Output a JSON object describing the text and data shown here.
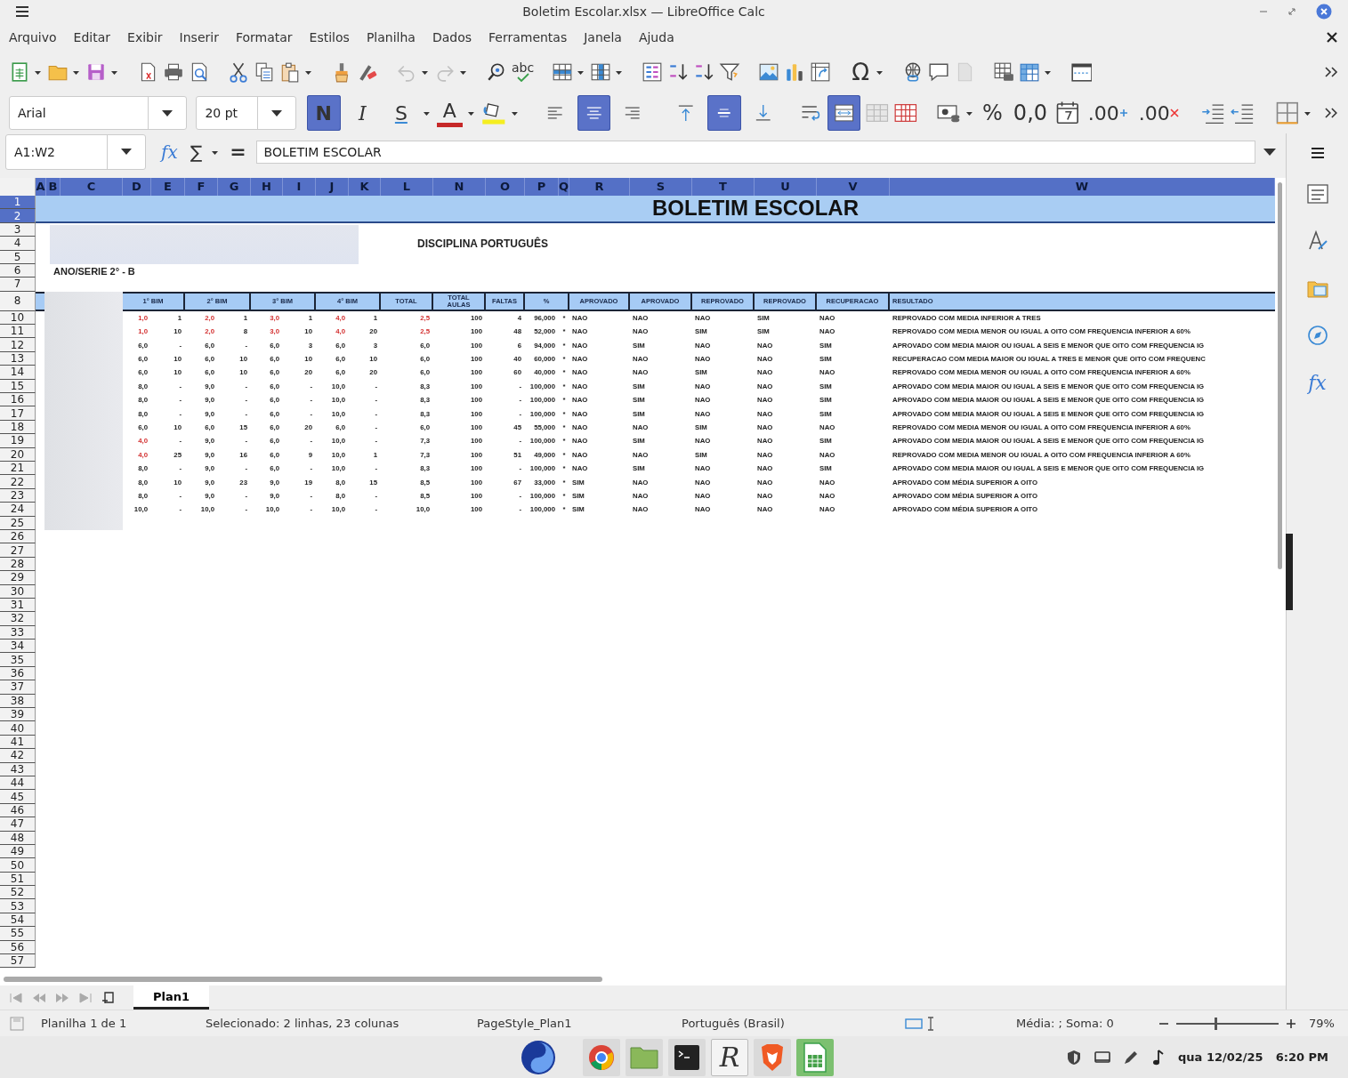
{
  "window": {
    "title": "Boletim Escolar.xlsx — LibreOffice Calc"
  },
  "menu": [
    "Arquivo",
    "Editar",
    "Exibir",
    "Inserir",
    "Formatar",
    "Estilos",
    "Planilha",
    "Dados",
    "Ferramentas",
    "Janela",
    "Ajuda"
  ],
  "standard_toolbar": {
    "spellcheck_label": "abc",
    "special_character": "Ω"
  },
  "formatting_toolbar": {
    "font_name": "Arial",
    "font_size": "20 pt",
    "bold": {
      "label": "N",
      "selected": true
    },
    "italic": {
      "label": "I",
      "selected": false
    },
    "underline": {
      "label": "S",
      "selected": false
    },
    "font_color": {
      "label": "A"
    },
    "horizontal_align": [
      {
        "selected": false
      },
      {
        "selected": true
      },
      {
        "selected": false
      }
    ],
    "vertical_align": [
      {
        "selected": false
      },
      {
        "selected": true
      },
      {
        "selected": false
      }
    ],
    "merge_and_center": {
      "selected": true
    },
    "percent": "%",
    "number_format": "0,0",
    "add_decimal": ".00",
    "delete_decimal": ".00"
  },
  "formula_bar": {
    "name_box": "A1:W2",
    "function_wizard": "fx",
    "sum": "∑",
    "equals": "=",
    "value": "BOLETIM ESCOLAR"
  },
  "sheet": {
    "column_headers": [
      {
        "label": "A",
        "selected": true
      },
      {
        "label": "B",
        "selected": true
      },
      {
        "label": "C",
        "selected": true
      },
      {
        "label": "D",
        "selected": true
      },
      {
        "label": "E",
        "selected": true
      },
      {
        "label": "F",
        "selected": true
      },
      {
        "label": "G",
        "selected": true
      },
      {
        "label": "H",
        "selected": true
      },
      {
        "label": "I",
        "selected": true
      },
      {
        "label": "J",
        "selected": true
      },
      {
        "label": "K",
        "selected": true
      },
      {
        "label": "L",
        "selected": true
      },
      {
        "label": "N",
        "selected": true
      },
      {
        "label": "O",
        "selected": true
      },
      {
        "label": "P",
        "selected": true
      },
      {
        "label": "Q",
        "selected": true
      },
      {
        "label": "R",
        "selected": true
      },
      {
        "label": "S",
        "selected": true
      },
      {
        "label": "T",
        "selected": true
      },
      {
        "label": "U",
        "selected": true
      },
      {
        "label": "V",
        "selected": true
      },
      {
        "label": "W",
        "selected": true
      }
    ],
    "row_headers": [
      {
        "label": "1",
        "selected": true
      },
      {
        "label": "2",
        "selected": true
      },
      {
        "label": "3",
        "selected": false
      },
      {
        "label": "4",
        "selected": false
      },
      {
        "label": "5",
        "selected": false
      },
      {
        "label": "6",
        "selected": false
      },
      {
        "label": "7",
        "selected": false
      },
      {
        "label": "8",
        "selected": false
      },
      {
        "label": "10",
        "selected": false
      },
      {
        "label": "11",
        "selected": false
      },
      {
        "label": "12",
        "selected": false
      },
      {
        "label": "13",
        "selected": false
      },
      {
        "label": "14",
        "selected": false
      },
      {
        "label": "15",
        "selected": false
      },
      {
        "label": "16",
        "selected": false
      },
      {
        "label": "17",
        "selected": false
      },
      {
        "label": "18",
        "selected": false
      },
      {
        "label": "19",
        "selected": false
      },
      {
        "label": "20",
        "selected": false
      },
      {
        "label": "21",
        "selected": false
      },
      {
        "label": "22",
        "selected": false
      },
      {
        "label": "23",
        "selected": false
      },
      {
        "label": "24",
        "selected": false
      },
      {
        "label": "25",
        "selected": false
      },
      {
        "label": "26",
        "selected": false
      },
      {
        "label": "27",
        "selected": false
      },
      {
        "label": "28",
        "selected": false
      },
      {
        "label": "29",
        "selected": false
      },
      {
        "label": "30",
        "selected": false
      },
      {
        "label": "31",
        "selected": false
      },
      {
        "label": "32",
        "selected": false
      },
      {
        "label": "33",
        "selected": false
      },
      {
        "label": "34",
        "selected": false
      },
      {
        "label": "35",
        "selected": false
      },
      {
        "label": "36",
        "selected": false
      },
      {
        "label": "37",
        "selected": false
      },
      {
        "label": "38",
        "selected": false
      },
      {
        "label": "39",
        "selected": false
      },
      {
        "label": "40",
        "selected": false
      },
      {
        "label": "41",
        "selected": false
      },
      {
        "label": "42",
        "selected": false
      },
      {
        "label": "43",
        "selected": false
      },
      {
        "label": "44",
        "selected": false
      },
      {
        "label": "45",
        "selected": false
      },
      {
        "label": "46",
        "selected": false
      },
      {
        "label": "47",
        "selected": false
      },
      {
        "label": "48",
        "selected": false
      },
      {
        "label": "49",
        "selected": false
      },
      {
        "label": "50",
        "selected": false
      },
      {
        "label": "51",
        "selected": false
      },
      {
        "label": "52",
        "selected": false
      },
      {
        "label": "53",
        "selected": false
      },
      {
        "label": "54",
        "selected": false
      },
      {
        "label": "55",
        "selected": false
      },
      {
        "label": "56",
        "selected": false
      },
      {
        "label": "57",
        "selected": false
      }
    ],
    "title": "BOLETIM ESCOLAR",
    "subject": "DISCIPLINA PORTUGUÊS",
    "class_label": "ANO/SERIE 2° - B",
    "table_headers": [
      "1° BIM",
      "2° BIM",
      "3° BIM",
      "4° BIM",
      "TOTAL",
      "TOTAL AULAS",
      "FALTAS",
      "%",
      "APROVADO",
      "APROVADO",
      "REPROVADO",
      "REPROVADO",
      "RECUPERACAO",
      "RESULTADO"
    ],
    "rows": [
      {
        "grades": [
          {
            "grade": "1,0",
            "low": true
          },
          {
            "grade": "2,0",
            "low": true
          },
          {
            "grade": "3,0",
            "low": true
          },
          {
            "grade": "4,0",
            "low": true
          }
        ],
        "absences": [
          "1",
          "1",
          "1",
          "1"
        ],
        "total": {
          "grade": "2,5",
          "low": true
        },
        "classes": "100",
        "missed": "4",
        "percent": "96,000",
        "mark": "*",
        "checks": [
          "NAO",
          "NAO",
          "NAO",
          "SIM",
          "NAO"
        ],
        "result": "REPROVADO COM MEDIA INFERIOR A TRES"
      },
      {
        "grades": [
          {
            "grade": "1,0",
            "low": true
          },
          {
            "grade": "2,0",
            "low": true
          },
          {
            "grade": "3,0",
            "low": true
          },
          {
            "grade": "4,0",
            "low": true
          }
        ],
        "absences": [
          "10",
          "8",
          "10",
          "20"
        ],
        "total": {
          "grade": "2,5",
          "low": true
        },
        "classes": "100",
        "missed": "48",
        "percent": "52,000",
        "mark": "*",
        "checks": [
          "NAO",
          "NAO",
          "SIM",
          "SIM",
          "NAO"
        ],
        "result": "REPROVADO COM MEDIA MENOR OU IGUAL A OITO COM FREQUENCIA INFERIOR A 60%"
      },
      {
        "grades": [
          {
            "grade": "6,0",
            "low": false
          },
          {
            "grade": "6,0",
            "low": false
          },
          {
            "grade": "6,0",
            "low": false
          },
          {
            "grade": "6,0",
            "low": false
          }
        ],
        "absences": [
          "-",
          "-",
          "3",
          "3"
        ],
        "total": {
          "grade": "6,0",
          "low": false
        },
        "classes": "100",
        "missed": "6",
        "percent": "94,000",
        "mark": "*",
        "checks": [
          "NAO",
          "SIM",
          "NAO",
          "NAO",
          "SIM"
        ],
        "result": "APROVADO COM MEDIA MAIOR OU IGUAL A SEIS E MENOR QUE OITO COM FREQUENCIA IG"
      },
      {
        "grades": [
          {
            "grade": "6,0",
            "low": false
          },
          {
            "grade": "6,0",
            "low": false
          },
          {
            "grade": "6,0",
            "low": false
          },
          {
            "grade": "6,0",
            "low": false
          }
        ],
        "absences": [
          "10",
          "10",
          "10",
          "10"
        ],
        "total": {
          "grade": "6,0",
          "low": false
        },
        "classes": "100",
        "missed": "40",
        "percent": "60,000",
        "mark": "*",
        "checks": [
          "NAO",
          "NAO",
          "NAO",
          "NAO",
          "SIM"
        ],
        "result": "RECUPERACAO COM MEDIA MAIOR OU IGUAL A TRES E MENOR QUE OITO COM FREQUENC"
      },
      {
        "grades": [
          {
            "grade": "6,0",
            "low": false
          },
          {
            "grade": "6,0",
            "low": false
          },
          {
            "grade": "6,0",
            "low": false
          },
          {
            "grade": "6,0",
            "low": false
          }
        ],
        "absences": [
          "10",
          "10",
          "20",
          "20"
        ],
        "total": {
          "grade": "6,0",
          "low": false
        },
        "classes": "100",
        "missed": "60",
        "percent": "40,000",
        "mark": "*",
        "checks": [
          "NAO",
          "NAO",
          "SIM",
          "NAO",
          "NAO"
        ],
        "result": "REPROVADO COM MEDIA MENOR OU IGUAL A OITO COM FREQUENCIA INFERIOR A 60%"
      },
      {
        "grades": [
          {
            "grade": "8,0",
            "low": false
          },
          {
            "grade": "9,0",
            "low": false
          },
          {
            "grade": "6,0",
            "low": false
          },
          {
            "grade": "10,0",
            "low": false
          }
        ],
        "absences": [
          "-",
          "-",
          "-",
          "-"
        ],
        "total": {
          "grade": "8,3",
          "low": false
        },
        "classes": "100",
        "missed": "-",
        "percent": "100,000",
        "mark": "*",
        "checks": [
          "NAO",
          "SIM",
          "NAO",
          "NAO",
          "SIM"
        ],
        "result": "APROVADO COM MEDIA MAIOR OU IGUAL A SEIS E MENOR QUE OITO COM FREQUENCIA IG"
      },
      {
        "grades": [
          {
            "grade": "8,0",
            "low": false
          },
          {
            "grade": "9,0",
            "low": false
          },
          {
            "grade": "6,0",
            "low": false
          },
          {
            "grade": "10,0",
            "low": false
          }
        ],
        "absences": [
          "-",
          "-",
          "-",
          "-"
        ],
        "total": {
          "grade": "8,3",
          "low": false
        },
        "classes": "100",
        "missed": "-",
        "percent": "100,000",
        "mark": "*",
        "checks": [
          "NAO",
          "SIM",
          "NAO",
          "NAO",
          "SIM"
        ],
        "result": "APROVADO COM MEDIA MAIOR OU IGUAL A SEIS E MENOR QUE OITO COM FREQUENCIA IG"
      },
      {
        "grades": [
          {
            "grade": "8,0",
            "low": false
          },
          {
            "grade": "9,0",
            "low": false
          },
          {
            "grade": "6,0",
            "low": false
          },
          {
            "grade": "10,0",
            "low": false
          }
        ],
        "absences": [
          "-",
          "-",
          "-",
          "-"
        ],
        "total": {
          "grade": "8,3",
          "low": false
        },
        "classes": "100",
        "missed": "-",
        "percent": "100,000",
        "mark": "*",
        "checks": [
          "NAO",
          "SIM",
          "NAO",
          "NAO",
          "SIM"
        ],
        "result": "APROVADO COM MEDIA MAIOR OU IGUAL A SEIS E MENOR QUE OITO COM FREQUENCIA IG"
      },
      {
        "grades": [
          {
            "grade": "6,0",
            "low": false
          },
          {
            "grade": "6,0",
            "low": false
          },
          {
            "grade": "6,0",
            "low": false
          },
          {
            "grade": "6,0",
            "low": false
          }
        ],
        "absences": [
          "10",
          "15",
          "20",
          "-"
        ],
        "total": {
          "grade": "6,0",
          "low": false
        },
        "classes": "100",
        "missed": "45",
        "percent": "55,000",
        "mark": "*",
        "checks": [
          "NAO",
          "NAO",
          "SIM",
          "NAO",
          "NAO"
        ],
        "result": "REPROVADO COM MEDIA MENOR OU IGUAL A OITO COM FREQUENCIA INFERIOR A 60%"
      },
      {
        "grades": [
          {
            "grade": "4,0",
            "low": true
          },
          {
            "grade": "9,0",
            "low": false
          },
          {
            "grade": "6,0",
            "low": false
          },
          {
            "grade": "10,0",
            "low": false
          }
        ],
        "absences": [
          "-",
          "-",
          "-",
          "-"
        ],
        "total": {
          "grade": "7,3",
          "low": false
        },
        "classes": "100",
        "missed": "-",
        "percent": "100,000",
        "mark": "*",
        "checks": [
          "NAO",
          "SIM",
          "NAO",
          "NAO",
          "SIM"
        ],
        "result": "APROVADO COM MEDIA MAIOR OU IGUAL A SEIS E MENOR QUE OITO COM FREQUENCIA IG"
      },
      {
        "grades": [
          {
            "grade": "4,0",
            "low": true
          },
          {
            "grade": "9,0",
            "low": false
          },
          {
            "grade": "6,0",
            "low": false
          },
          {
            "grade": "10,0",
            "low": false
          }
        ],
        "absences": [
          "25",
          "16",
          "9",
          "1"
        ],
        "total": {
          "grade": "7,3",
          "low": false
        },
        "classes": "100",
        "missed": "51",
        "percent": "49,000",
        "mark": "*",
        "checks": [
          "NAO",
          "NAO",
          "SIM",
          "NAO",
          "NAO"
        ],
        "result": "REPROVADO COM MEDIA MENOR OU IGUAL A OITO COM FREQUENCIA INFERIOR A 60%"
      },
      {
        "grades": [
          {
            "grade": "8,0",
            "low": false
          },
          {
            "grade": "9,0",
            "low": false
          },
          {
            "grade": "6,0",
            "low": false
          },
          {
            "grade": "10,0",
            "low": false
          }
        ],
        "absences": [
          "-",
          "-",
          "-",
          "-"
        ],
        "total": {
          "grade": "8,3",
          "low": false
        },
        "classes": "100",
        "missed": "-",
        "percent": "100,000",
        "mark": "*",
        "checks": [
          "NAO",
          "SIM",
          "NAO",
          "NAO",
          "SIM"
        ],
        "result": "APROVADO COM MEDIA MAIOR OU IGUAL A SEIS E MENOR QUE OITO COM FREQUENCIA IG"
      },
      {
        "grades": [
          {
            "grade": "8,0",
            "low": false
          },
          {
            "grade": "9,0",
            "low": false
          },
          {
            "grade": "9,0",
            "low": false
          },
          {
            "grade": "8,0",
            "low": false
          }
        ],
        "absences": [
          "10",
          "23",
          "19",
          "15"
        ],
        "total": {
          "grade": "8,5",
          "low": false
        },
        "classes": "100",
        "missed": "67",
        "percent": "33,000",
        "mark": "*",
        "checks": [
          "SIM",
          "NAO",
          "NAO",
          "NAO",
          "NAO"
        ],
        "result": "APROVADO COM MÉDIA SUPERIOR A OITO"
      },
      {
        "grades": [
          {
            "grade": "8,0",
            "low": false
          },
          {
            "grade": "9,0",
            "low": false
          },
          {
            "grade": "9,0",
            "low": false
          },
          {
            "grade": "8,0",
            "low": false
          }
        ],
        "absences": [
          "-",
          "-",
          "-",
          "-"
        ],
        "total": {
          "grade": "8,5",
          "low": false
        },
        "classes": "100",
        "missed": "-",
        "percent": "100,000",
        "mark": "*",
        "checks": [
          "SIM",
          "NAO",
          "NAO",
          "NAO",
          "NAO"
        ],
        "result": "APROVADO COM MÉDIA SUPERIOR A OITO"
      },
      {
        "grades": [
          {
            "grade": "10,0",
            "low": false
          },
          {
            "grade": "10,0",
            "low": false
          },
          {
            "grade": "10,0",
            "low": false
          },
          {
            "grade": "10,0",
            "low": false
          }
        ],
        "absences": [
          "-",
          "-",
          "-",
          "-"
        ],
        "total": {
          "grade": "10,0",
          "low": false
        },
        "classes": "100",
        "missed": "-",
        "percent": "100,000",
        "mark": "*",
        "checks": [
          "SIM",
          "NAO",
          "NAO",
          "NAO",
          "NAO"
        ],
        "result": "APROVADO COM MÉDIA SUPERIOR A OITO"
      }
    ]
  },
  "sheet_tabs": [
    {
      "label": "Plan1",
      "selected": true
    }
  ],
  "sidebar": {
    "function_label": "fx"
  },
  "status_bar": {
    "sheet": "Planilha 1 de 1",
    "selection": "Selecionado: 2 linhas, 23 colunas",
    "page_style": "PageStyle_Plan1",
    "language": "Português (Brasil)",
    "summary": "Média: ; Soma: 0",
    "zoom": {
      "level": 0.37,
      "label": "79%"
    }
  },
  "taskbar": {
    "r_label": "R",
    "date": "qua 12/02/25",
    "time": "6:20 PM"
  }
}
